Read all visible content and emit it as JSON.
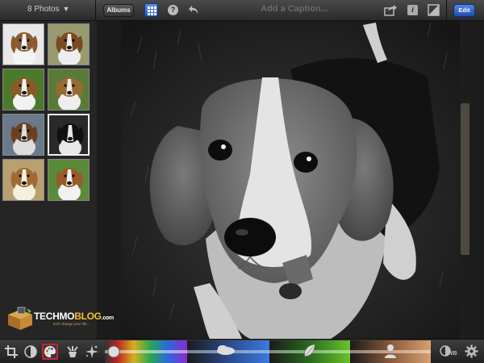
{
  "toolbar": {
    "photos_count": "8 Photos",
    "photos_dropdown_icon": "triangle-down-icon",
    "albums_label": "Albums",
    "grid_icon": "grid-icon",
    "help_icon": "question-icon",
    "help_label": "?",
    "undo_icon": "undo-icon",
    "caption_placeholder": "Add a Caption...",
    "share_icon": "share-icon",
    "info_icon": "info-icon",
    "info_label": "i",
    "compare_icon": "compare-icon",
    "edit_label": "Edit"
  },
  "thumbnails": [
    {
      "name": "beagle-puppy-blanket",
      "selected": false
    },
    {
      "name": "beagle-standing-grass",
      "selected": false
    },
    {
      "name": "beagle-sitting-lawn",
      "selected": false
    },
    {
      "name": "beagle-puppies-group",
      "selected": false
    },
    {
      "name": "beagle-side-view",
      "selected": false
    },
    {
      "name": "beagle-portrait-dark",
      "selected": true
    },
    {
      "name": "beagle-puppy-sepia",
      "selected": false
    },
    {
      "name": "beagle-puppy-garden",
      "selected": false
    }
  ],
  "watermark": {
    "title_main": "TECHMO",
    "title_accent": "BLOG",
    "title_suffix": ".com",
    "tagline": "tech change your life..."
  },
  "main_photo": {
    "subject": "beagle-portrait-black-and-white"
  },
  "bottom_tools": [
    {
      "name": "crop-icon",
      "active": false
    },
    {
      "name": "adjust-exposure-icon",
      "active": false
    },
    {
      "name": "color-palette-icon",
      "active": true
    },
    {
      "name": "brushes-icon",
      "active": false
    },
    {
      "name": "effects-icon",
      "active": false
    }
  ],
  "color_strips": [
    {
      "name": "saturation-strip",
      "icon": "sphere-icon"
    },
    {
      "name": "blue-sky-strip",
      "icon": "cloud-icon"
    },
    {
      "name": "greenery-strip",
      "icon": "leaf-icon"
    },
    {
      "name": "skin-tone-strip",
      "icon": "person-icon"
    }
  ],
  "bottom_right": {
    "wb_icon": "white-balance-icon",
    "wb_label": "WB",
    "settings_icon": "gear-icon"
  },
  "colors": {
    "accent_blue": "#2d5cc0",
    "active_tool_border": "#d0202a",
    "watermark_yellow": "#f2c029"
  }
}
